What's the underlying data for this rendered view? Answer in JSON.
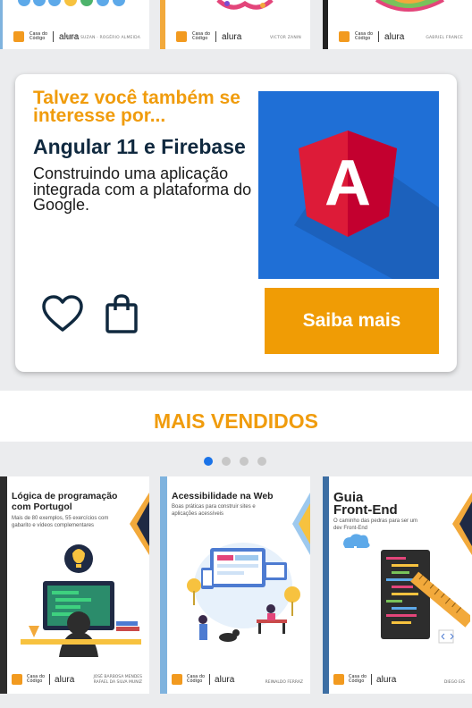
{
  "top_strip": {
    "covers": [
      {
        "publisher": "Casa do\nCódigo",
        "brand": "alura",
        "author": "ARTUR SUZAN · ROGÉRIO ALMEIDA"
      },
      {
        "publisher": "Casa do\nCódigo",
        "brand": "alura",
        "author": "VICTOR ZANIN"
      },
      {
        "publisher": "Casa do\nCódigo",
        "brand": "alura",
        "author": "GABRIEL FRANCE"
      }
    ]
  },
  "recommendation": {
    "kicker": "Talvez você também se interesse por...",
    "title": "Angular 11 e Firebase",
    "description": "Construindo uma aplicação integrada com a plataforma do Google.",
    "cta_label": "Saiba mais",
    "cover_letter": "A",
    "icons": {
      "favorite": "heart-icon",
      "cart": "shopping-bag-icon"
    }
  },
  "bestsellers": {
    "heading": "MAIS VENDIDOS",
    "carousel": {
      "pages": 4,
      "active_page": 1
    },
    "books": [
      {
        "title": "Lógica de programação com Portugol",
        "subtitle": "Mais de 80 exemplos, 55 exercícios com gabarito e vídeos complementares",
        "publisher": "Casa do\nCódigo",
        "brand": "alura",
        "author": "JOSÉ BARBOSA MENDES\nRAFAEL DA SILVA MUNIZ",
        "accent": "#f2a93b"
      },
      {
        "title": "Acessibilidade na Web",
        "subtitle": "Boas práticas para construir sites e aplicações acessíveis",
        "publisher": "Casa do\nCódigo",
        "brand": "alura",
        "author": "REINALDO FERRAZ",
        "accent": "#7fb3de"
      },
      {
        "title": "Guia Front-End",
        "subtitle": "O caminho das pedras para ser um dev Front-End",
        "publisher": "Casa do\nCódigo",
        "brand": "alura",
        "author": "DIEGO EIS",
        "accent": "#f2a93b"
      }
    ]
  },
  "colors": {
    "accent_orange": "#f09c0d",
    "title_navy": "#10293f",
    "angular_blue": "#1f6fd6",
    "angular_red": "#dd1b38",
    "dot_active": "#1a73e8"
  }
}
